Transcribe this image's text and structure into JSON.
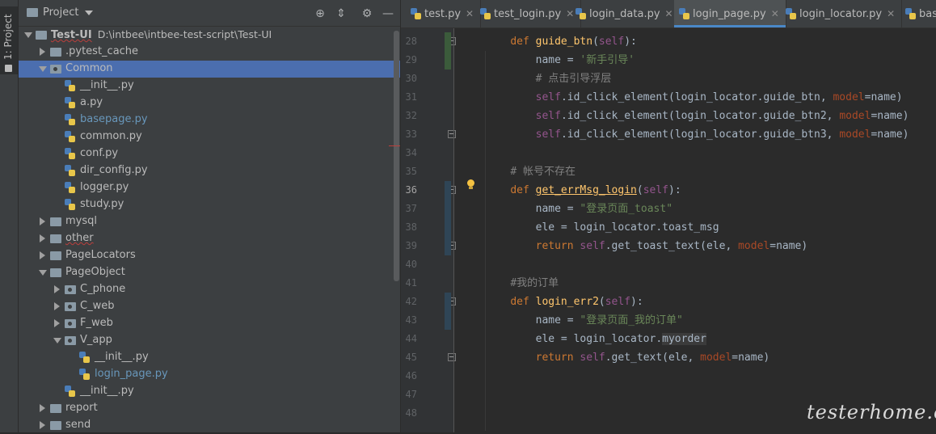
{
  "sidebar_tab": {
    "label": "1: Project"
  },
  "panel": {
    "title": "Project"
  },
  "tree": [
    {
      "label": "Test-UI",
      "path": "D:\\intbee\\intbee-test-script\\Test-UI",
      "type": "folder",
      "depth": 0,
      "expanded": true,
      "root": true
    },
    {
      "label": ".pytest_cache",
      "type": "folder",
      "depth": 1,
      "expanded": false
    },
    {
      "label": "Common",
      "type": "package",
      "depth": 1,
      "expanded": true,
      "selected": true
    },
    {
      "label": "__init__.py",
      "type": "py",
      "depth": 2
    },
    {
      "label": "a.py",
      "type": "py",
      "depth": 2
    },
    {
      "label": "basepage.py",
      "type": "py",
      "depth": 2,
      "link": true
    },
    {
      "label": "common.py",
      "type": "py",
      "depth": 2
    },
    {
      "label": "conf.py",
      "type": "py",
      "depth": 2
    },
    {
      "label": "dir_config.py",
      "type": "py",
      "depth": 2
    },
    {
      "label": "logger.py",
      "type": "py",
      "depth": 2
    },
    {
      "label": "study.py",
      "type": "py",
      "depth": 2
    },
    {
      "label": "mysql",
      "type": "folder",
      "depth": 1,
      "expanded": false
    },
    {
      "label": "other",
      "type": "folder",
      "depth": 1,
      "expanded": false,
      "wavy": true
    },
    {
      "label": "PageLocators",
      "type": "folder",
      "depth": 1,
      "expanded": false
    },
    {
      "label": "PageObject",
      "type": "folder",
      "depth": 1,
      "expanded": true
    },
    {
      "label": "C_phone",
      "type": "package",
      "depth": 2,
      "expanded": false
    },
    {
      "label": "C_web",
      "type": "package",
      "depth": 2,
      "expanded": false
    },
    {
      "label": "F_web",
      "type": "package",
      "depth": 2,
      "expanded": false
    },
    {
      "label": "V_app",
      "type": "package",
      "depth": 2,
      "expanded": true
    },
    {
      "label": "__init__.py",
      "type": "py",
      "depth": 3
    },
    {
      "label": "login_page.py",
      "type": "py",
      "depth": 3,
      "link": true
    },
    {
      "label": "__init__.py",
      "type": "py",
      "depth": 2
    },
    {
      "label": "report",
      "type": "folder",
      "depth": 1,
      "expanded": false
    },
    {
      "label": "send",
      "type": "folder",
      "depth": 1,
      "expanded": false
    }
  ],
  "tabs": [
    {
      "label": "test.py"
    },
    {
      "label": "test_login.py"
    },
    {
      "label": "login_data.py"
    },
    {
      "label": "login_page.py",
      "active": true
    },
    {
      "label": "login_locator.py"
    },
    {
      "label": "base"
    }
  ],
  "editor": {
    "current_line": 36,
    "lines": [
      {
        "n": 28,
        "tokens": [
          [
            "    ",
            ""
          ],
          [
            "def ",
            "kw"
          ],
          [
            "guide_btn",
            "fn"
          ],
          [
            "(",
            ""
          ],
          [
            "self",
            "self"
          ],
          [
            "):",
            ""
          ]
        ]
      },
      {
        "n": 29,
        "tokens": [
          [
            "        name = ",
            ""
          ],
          [
            "'新手引导'",
            "str"
          ]
        ]
      },
      {
        "n": 30,
        "tokens": [
          [
            "        ",
            ""
          ],
          [
            "# 点击引导浮层",
            "cmt"
          ]
        ]
      },
      {
        "n": 31,
        "tokens": [
          [
            "        ",
            ""
          ],
          [
            "self",
            "self"
          ],
          [
            ".id_click_element(login_locator.guide_btn, ",
            ""
          ],
          [
            "model",
            "param"
          ],
          [
            "=name)",
            ""
          ]
        ]
      },
      {
        "n": 32,
        "tokens": [
          [
            "        ",
            ""
          ],
          [
            "self",
            "self"
          ],
          [
            ".id_click_element(login_locator.guide_btn2, ",
            ""
          ],
          [
            "model",
            "param"
          ],
          [
            "=name)",
            ""
          ]
        ]
      },
      {
        "n": 33,
        "tokens": [
          [
            "        ",
            ""
          ],
          [
            "self",
            "self"
          ],
          [
            ".id_click_element(login_locator.guide_btn3, ",
            ""
          ],
          [
            "model",
            "param"
          ],
          [
            "=name)",
            ""
          ]
        ]
      },
      {
        "n": 34,
        "tokens": []
      },
      {
        "n": 35,
        "tokens": [
          [
            "    ",
            ""
          ],
          [
            "# 帐号不存在",
            "cmt"
          ]
        ]
      },
      {
        "n": 36,
        "tokens": [
          [
            "    ",
            ""
          ],
          [
            "def ",
            "kw"
          ],
          [
            "get_errMsg_login",
            "fn-hl"
          ],
          [
            "(",
            ""
          ],
          [
            "self",
            "self"
          ],
          [
            "):",
            ""
          ]
        ]
      },
      {
        "n": 37,
        "tokens": [
          [
            "        name = ",
            ""
          ],
          [
            "\"登录页面_toast\"",
            "str"
          ]
        ]
      },
      {
        "n": 38,
        "tokens": [
          [
            "        ele = login_locator.toast_msg",
            ""
          ]
        ]
      },
      {
        "n": 39,
        "tokens": [
          [
            "        ",
            ""
          ],
          [
            "return ",
            "kw"
          ],
          [
            "self",
            "self"
          ],
          [
            ".get_toast_text(ele, ",
            ""
          ],
          [
            "model",
            "param"
          ],
          [
            "=name)",
            ""
          ]
        ]
      },
      {
        "n": 40,
        "tokens": []
      },
      {
        "n": 41,
        "tokens": [
          [
            "    ",
            ""
          ],
          [
            "#我的订单",
            "cmt"
          ]
        ]
      },
      {
        "n": 42,
        "tokens": [
          [
            "    ",
            ""
          ],
          [
            "def ",
            "kw"
          ],
          [
            "login_err2",
            "fn"
          ],
          [
            "(",
            ""
          ],
          [
            "self",
            "self"
          ],
          [
            "):",
            ""
          ]
        ]
      },
      {
        "n": 43,
        "tokens": [
          [
            "        name = ",
            ""
          ],
          [
            "\"登录页面_我的订单\"",
            "str"
          ]
        ]
      },
      {
        "n": 44,
        "tokens": [
          [
            "        ele = login_locator.",
            ""
          ],
          [
            "myorder",
            "myorder"
          ]
        ]
      },
      {
        "n": 45,
        "tokens": [
          [
            "        ",
            ""
          ],
          [
            "return ",
            "kw"
          ],
          [
            "self",
            "self"
          ],
          [
            ".get_text(ele, ",
            ""
          ],
          [
            "model",
            "param"
          ],
          [
            "=name)",
            ""
          ]
        ]
      },
      {
        "n": 46,
        "tokens": []
      },
      {
        "n": 47,
        "tokens": []
      },
      {
        "n": 48,
        "tokens": []
      }
    ]
  },
  "watermark": {
    "text": "testerhome.com"
  }
}
